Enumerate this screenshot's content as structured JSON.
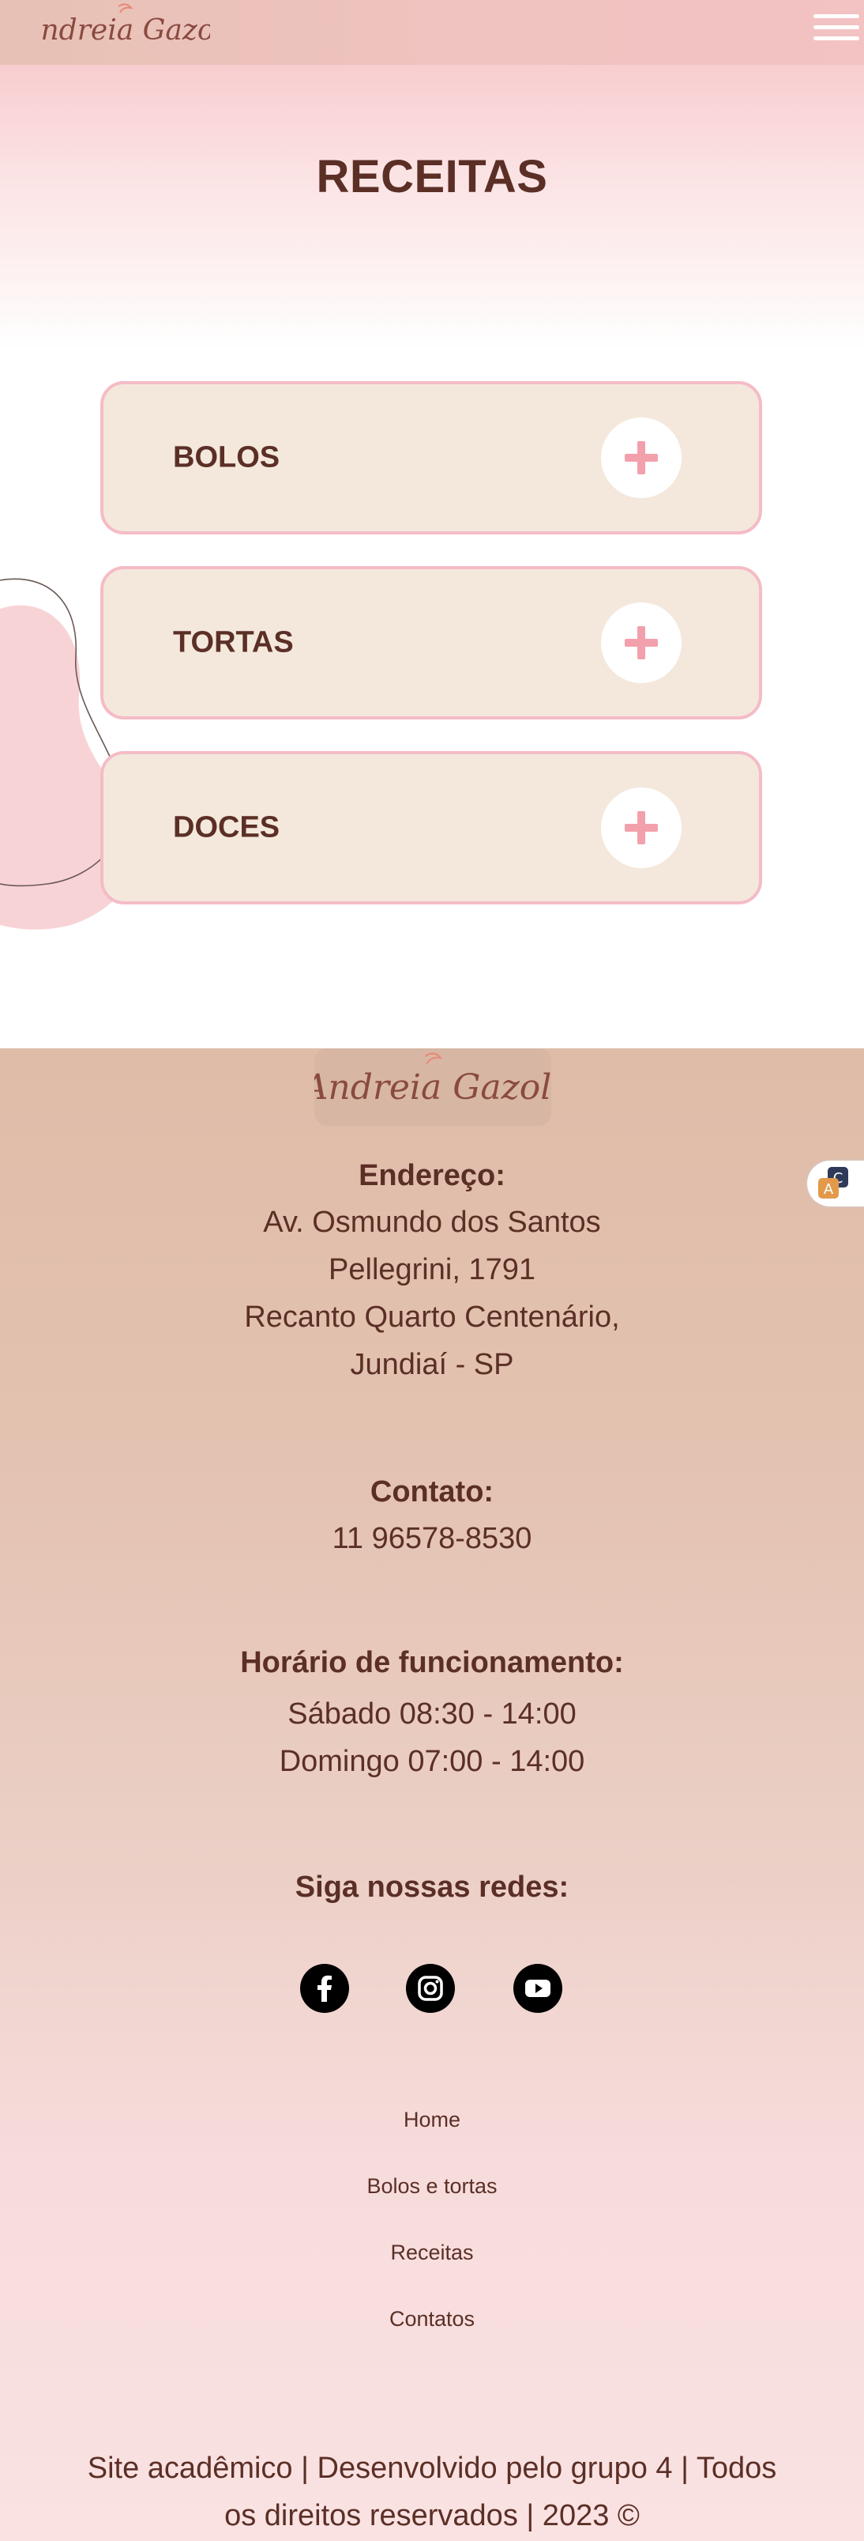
{
  "header": {
    "logo_text": "Andreia Gazoli",
    "menu_icon": "hamburger-menu-icon"
  },
  "hero": {
    "title": "RECEITAS"
  },
  "accordion": {
    "items": [
      {
        "label": "BOLOS",
        "icon": "plus-icon"
      },
      {
        "label": "TORTAS",
        "icon": "plus-icon"
      },
      {
        "label": "DOCES",
        "icon": "plus-icon"
      }
    ]
  },
  "footer": {
    "logo_text": "Andreia Gazoli",
    "address": {
      "heading": "Endereço:",
      "lines": [
        "Av. Osmundo dos Santos",
        "Pellegrini, 1791",
        "Recanto Quarto Centenário,",
        "Jundiaí - SP"
      ]
    },
    "contact": {
      "heading": "Contato:",
      "phone": "11 96578-8530"
    },
    "hours": {
      "heading": "Horário de funcionamento:",
      "lines": [
        "Sábado 08:30 - 14:00",
        "Domingo 07:00 - 14:00"
      ]
    },
    "social": {
      "heading": "Siga nossas redes:",
      "icons": [
        "facebook-icon",
        "instagram-icon",
        "youtube-icon"
      ]
    },
    "links": [
      "Home",
      "Bolos e tortas",
      "Receitas",
      "Contatos"
    ],
    "copyright_lines": [
      "Site acadêmico | Desenvolvido pelo grupo 4 | Todos",
      "os direitos reservados | 2023 ©"
    ]
  },
  "colors": {
    "brand_brown": "#5b2f26",
    "header_pink": "#efc3bf",
    "card_bg": "#f4e8dc",
    "card_border": "#f4bcc6",
    "plus_pink": "#f2a0ac",
    "footer_top": "#dfbca8",
    "footer_bottom": "#fae2e2"
  }
}
